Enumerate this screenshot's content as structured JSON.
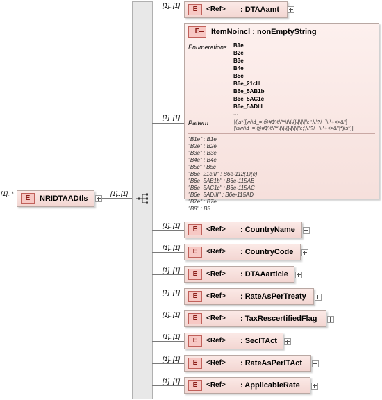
{
  "root": {
    "multiplicity": "[1]..*",
    "badge": "E",
    "name": "NRIDTAADtls"
  },
  "sequence": {
    "multiplicity": "[1]..[1]"
  },
  "elements": [
    {
      "multiplicity": "[1]..[1]",
      "badge": "E",
      "ref": "<Ref>",
      "name": ": DTAAamt"
    },
    {
      "multiplicity": "[1]..[1]",
      "badge": "E",
      "ref": "<Ref>",
      "name": ": CountryName"
    },
    {
      "multiplicity": "[1]..[1]",
      "badge": "E",
      "ref": "<Ref>",
      "name": ": CountryCode"
    },
    {
      "multiplicity": "[1]..[1]",
      "badge": "E",
      "ref": "<Ref>",
      "name": ": DTAAarticle"
    },
    {
      "multiplicity": "[1]..[1]",
      "badge": "E",
      "ref": "<Ref>",
      "name": ": RateAsPerTreaty"
    },
    {
      "multiplicity": "[1]..[1]",
      "badge": "E",
      "ref": "<Ref>",
      "name": ": TaxRescertifiedFlag"
    },
    {
      "multiplicity": "[1]..[1]",
      "badge": "E",
      "ref": "<Ref>",
      "name": ": SecITAct"
    },
    {
      "multiplicity": "[1]..[1]",
      "badge": "E",
      "ref": "<Ref>",
      "name": ": RateAsPerITAct"
    },
    {
      "multiplicity": "[1]..[1]",
      "badge": "E",
      "ref": "<Ref>",
      "name": ": ApplicableRate"
    }
  ],
  "item": {
    "multiplicity": "[1]..[1]",
    "badge": "E",
    "title": "ItemNoincl : nonEmptyString",
    "enumerations_label": "Enumerations",
    "enumerations": [
      "B1e",
      "B2e",
      "B3e",
      "B4e",
      "B5c",
      "B6e_21cIII",
      "B6e_5AB1b",
      "B6e_5AC1c",
      "B6e_5ADIII",
      "..."
    ],
    "pattern_label": "Pattern",
    "pattern_lines": [
      "[(\\s*([\\w\\d_=!@#$%\\^*\\(\\)\\{}\\[\\]\\|\\\\:;',\\.\\?/~`\\-\\+<>&\"]",
      "[\\s\\w\\d_=!@#$%\\^*\\(\\)\\{}\\[\\]\\|\\\\:;',\\.\\?/~`\\-\\+<>&\"]*)\\s*)]"
    ],
    "docs": [
      "\"B1e\" : B1e",
      "\"B2e\" : B2e",
      "\"B3e\" : B3e",
      "\"B4e\" : B4e",
      "\"B5c\" : B5c",
      "\"B6e_21cIII\" : B6e-112(1)(c)",
      "\"B6e_5AB1b\" : B6e-115AB",
      "\"B6e_5AC1c\" : B6e-115AC",
      "\"B6e_5ADIII\" : B6e-115AD",
      "\"B7e\" : B7e",
      "\"B8\" : B8"
    ]
  },
  "colors": {
    "card": "#f3d6d2",
    "badge": "#f7c8c4",
    "border": "#b9a8a3",
    "line": "#7a7a7a",
    "bar": "#e8e8e8"
  }
}
